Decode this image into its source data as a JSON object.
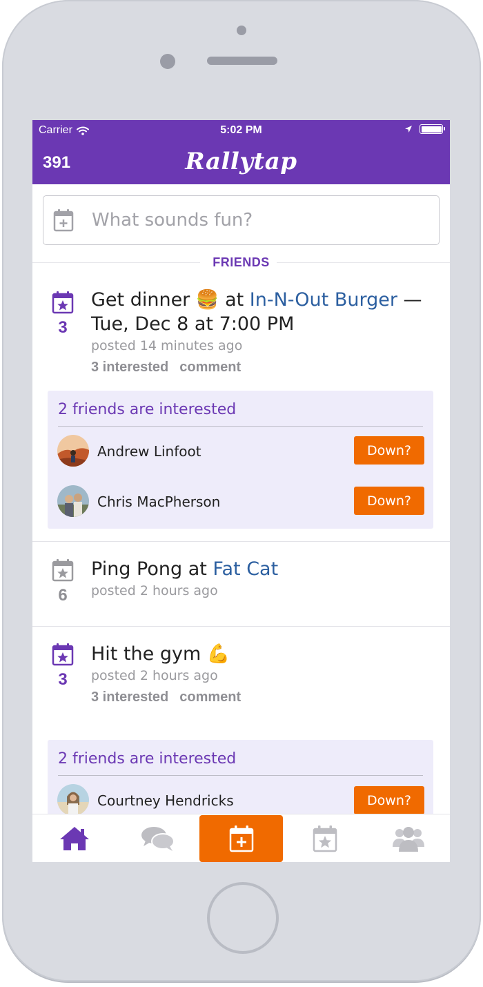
{
  "status_bar": {
    "carrier": "Carrier",
    "time": "5:02 PM"
  },
  "header": {
    "score": "391",
    "app_title": "Rallytap"
  },
  "search": {
    "placeholder": "What sounds fun?"
  },
  "section_label": "FRIENDS",
  "posts": [
    {
      "title_prefix": "Get dinner 🍔 at ",
      "venue": "In-N-Out Burger",
      "title_suffix": " — Tue, Dec 8 at 7:00 PM",
      "count": "3",
      "posted": "posted 14 minutes ago",
      "interested_label": "3 interested",
      "comment_label": "comment",
      "friends_header": "2 friends are interested",
      "friends": [
        {
          "name": "Andrew Linfoot",
          "button": "Down?"
        },
        {
          "name": "Chris MacPherson",
          "button": "Down?"
        }
      ]
    },
    {
      "title_prefix": "Ping Pong at ",
      "venue": "Fat Cat",
      "count": "6",
      "posted": "posted 2 hours ago"
    },
    {
      "title_prefix": "Hit the gym 💪",
      "count": "3",
      "posted": "posted 2 hours ago",
      "interested_label": "3 interested",
      "comment_label": "comment",
      "friends_header": "2 friends are interested",
      "friends": [
        {
          "name": "Courtney Hendricks",
          "button": "Down?"
        }
      ]
    }
  ],
  "tabs": [
    {
      "icon": "home-icon",
      "active": false
    },
    {
      "icon": "chat-icon",
      "active": false
    },
    {
      "icon": "calendar-plus-icon",
      "active": true
    },
    {
      "icon": "calendar-star-icon",
      "active": false
    },
    {
      "icon": "friends-icon",
      "active": false
    }
  ],
  "colors": {
    "brand_purple": "#6b38b3",
    "accent_orange": "#f06a00",
    "link_blue": "#2c5fa0",
    "friends_box_bg": "#eeecfa"
  }
}
